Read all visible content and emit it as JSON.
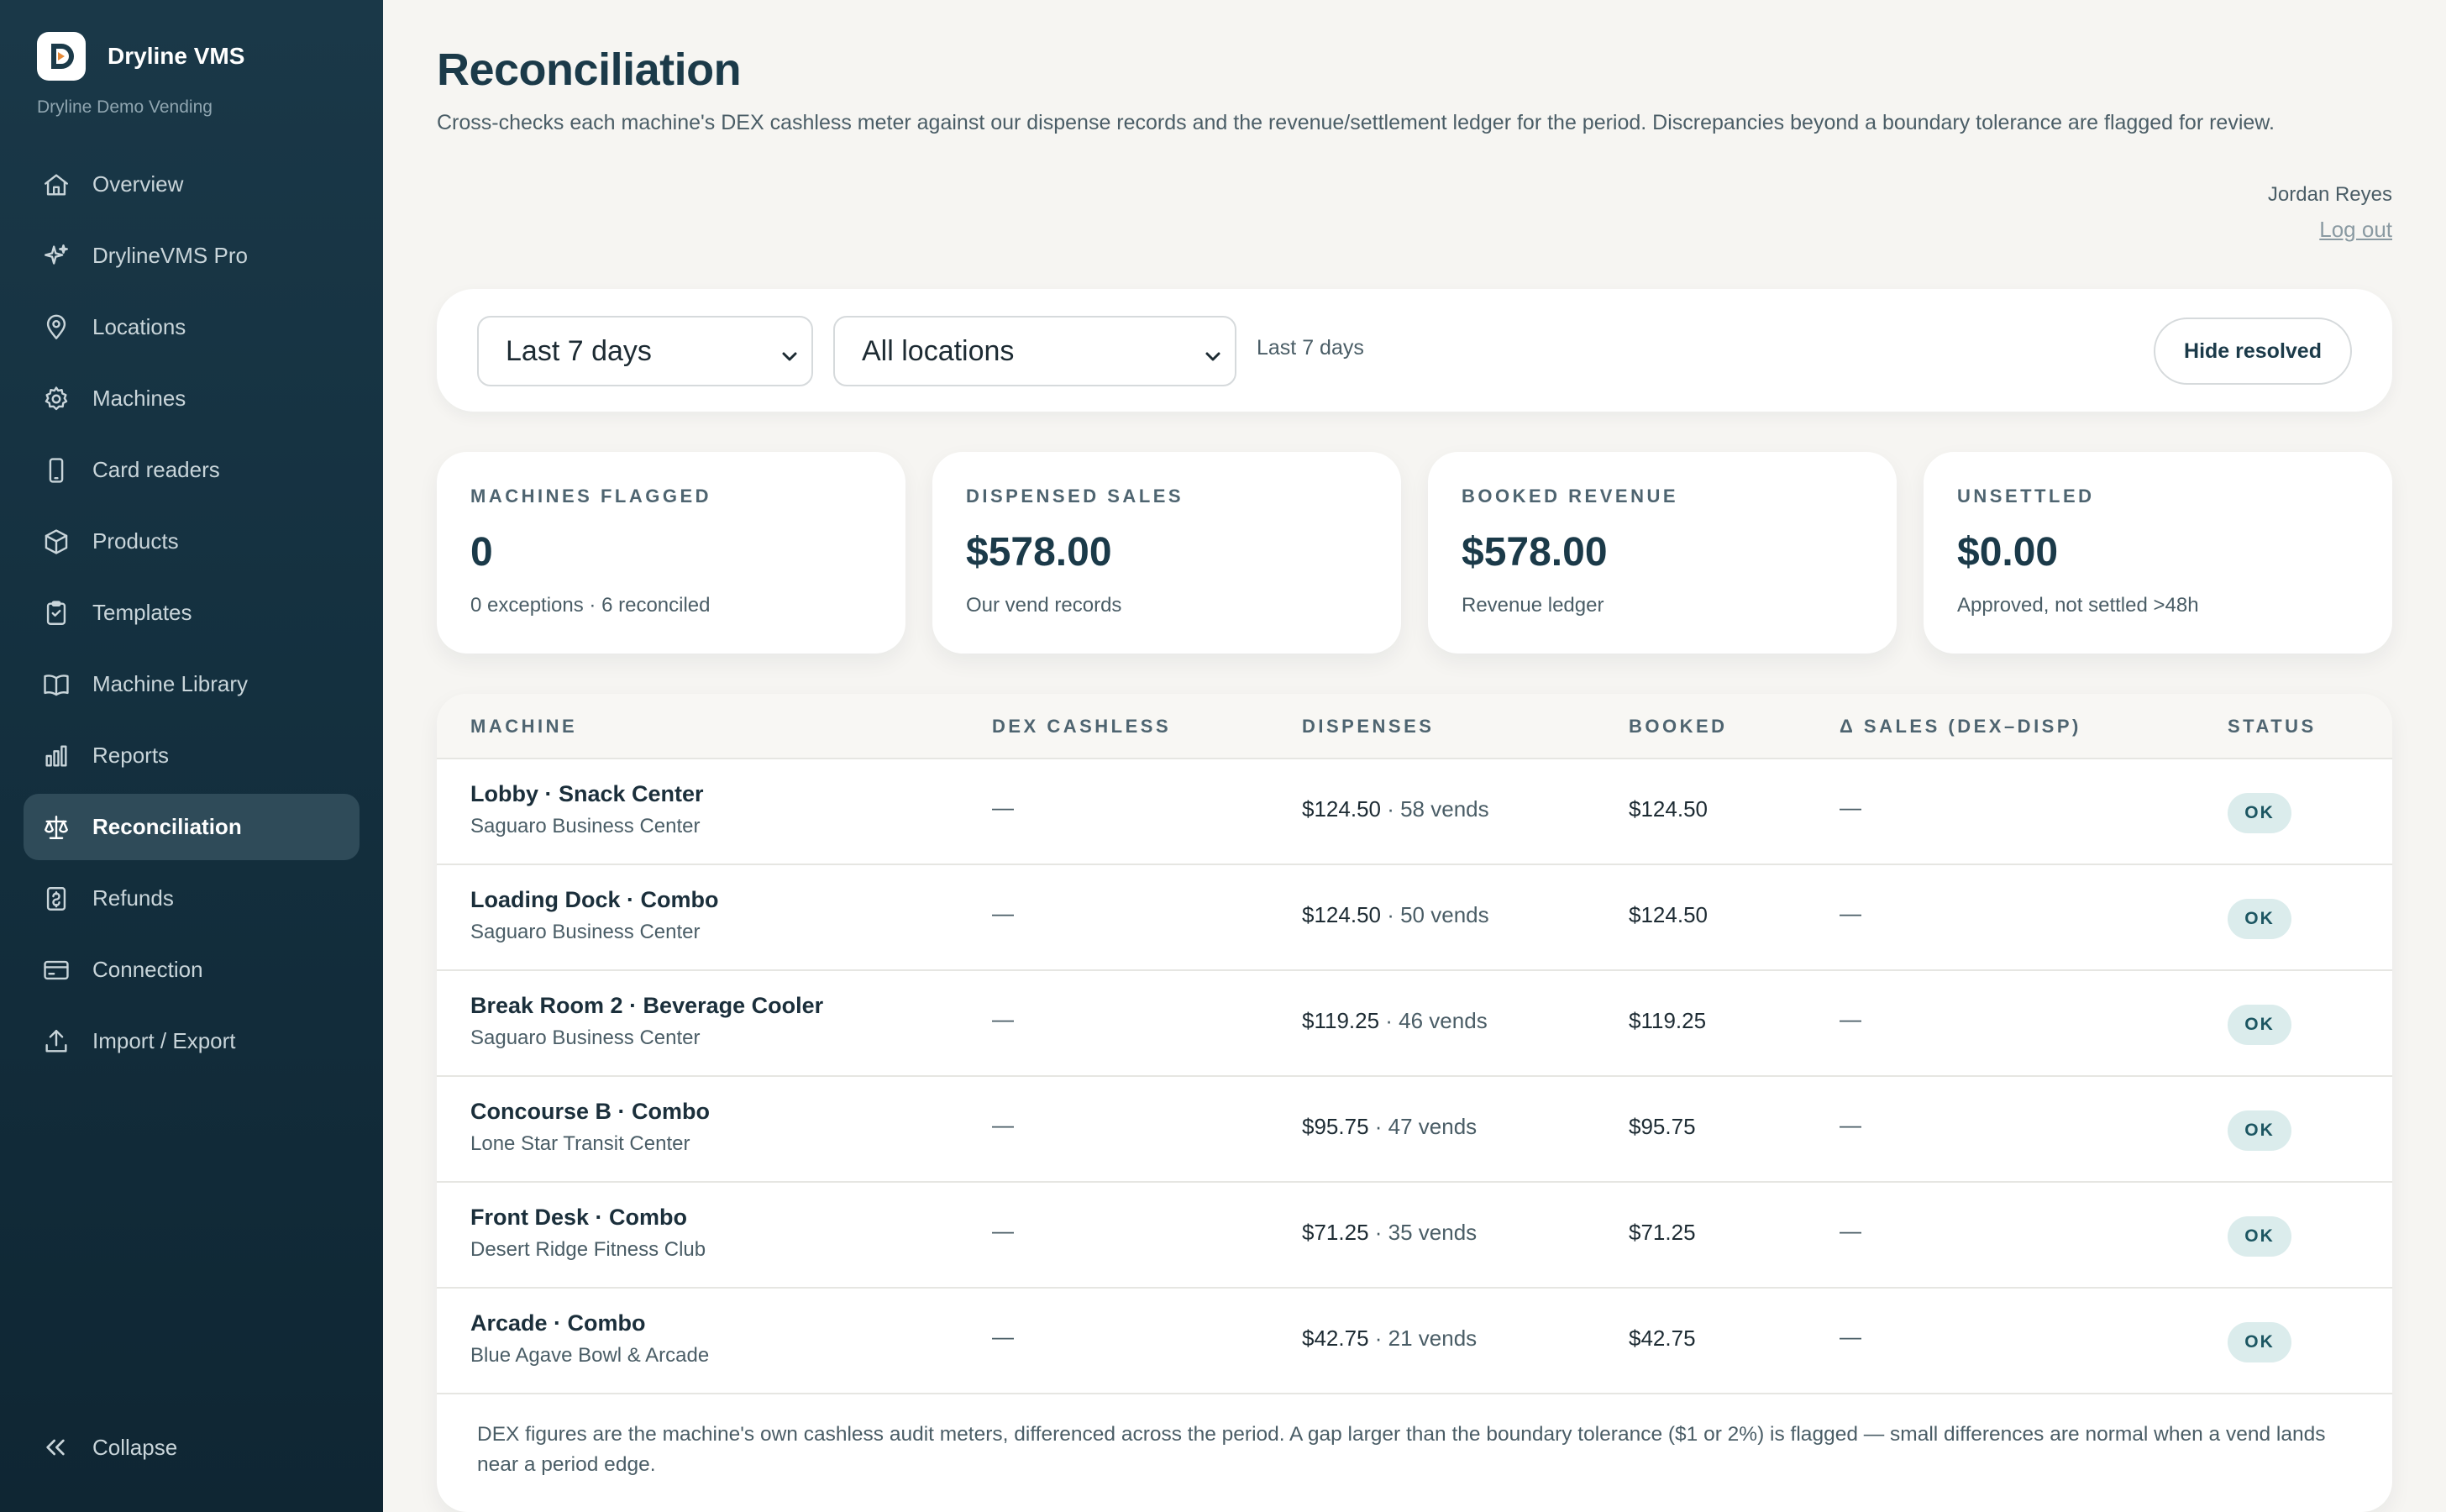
{
  "sidebar": {
    "brand_name": "Dryline VMS",
    "org_name": "Dryline Demo Vending",
    "items": [
      {
        "label": "Overview",
        "icon": "home-icon"
      },
      {
        "label": "DrylineVMS Pro",
        "icon": "sparkle-icon"
      },
      {
        "label": "Locations",
        "icon": "map-pin-icon"
      },
      {
        "label": "Machines",
        "icon": "gear-icon"
      },
      {
        "label": "Card readers",
        "icon": "phone-icon"
      },
      {
        "label": "Products",
        "icon": "box-icon"
      },
      {
        "label": "Templates",
        "icon": "clipboard-icon"
      },
      {
        "label": "Machine Library",
        "icon": "book-icon"
      },
      {
        "label": "Reports",
        "icon": "bar-chart-icon"
      },
      {
        "label": "Reconciliation",
        "icon": "scale-icon",
        "active": true
      },
      {
        "label": "Refunds",
        "icon": "receipt-icon"
      },
      {
        "label": "Connection",
        "icon": "card-icon"
      },
      {
        "label": "Import / Export",
        "icon": "upload-icon"
      }
    ],
    "collapse_label": "Collapse"
  },
  "header": {
    "title": "Reconciliation",
    "description": "Cross-checks each machine's DEX cashless meter against our dispense records and the revenue/settlement ledger for the period. Discrepancies beyond a boundary tolerance are flagged for review.",
    "user_name": "Jordan Reyes",
    "logout_label": "Log out"
  },
  "filters": {
    "period_value": "Last 7 days",
    "location_value": "All locations",
    "period_label": "Last 7 days",
    "hide_resolved_label": "Hide resolved"
  },
  "stats": [
    {
      "label": "MACHINES FLAGGED",
      "value": "0",
      "sub": "0 exceptions · 6 reconciled"
    },
    {
      "label": "DISPENSED SALES",
      "value": "$578.00",
      "sub": "Our vend records"
    },
    {
      "label": "BOOKED REVENUE",
      "value": "$578.00",
      "sub": "Revenue ledger"
    },
    {
      "label": "UNSETTLED",
      "value": "$0.00",
      "sub": "Approved, not settled >48h"
    }
  ],
  "table": {
    "columns": [
      "MACHINE",
      "DEX CASHLESS",
      "DISPENSES",
      "BOOKED",
      "Δ SALES (DEX–DISP)",
      "STATUS"
    ],
    "rows": [
      {
        "machine": "Lobby · Snack Center",
        "location": "Saguaro Business Center",
        "dex": "—",
        "dispense_amount": "$124.50",
        "dispense_vends": " · 58 vends",
        "booked": "$124.50",
        "delta": "—",
        "status": "OK"
      },
      {
        "machine": "Loading Dock · Combo",
        "location": "Saguaro Business Center",
        "dex": "—",
        "dispense_amount": "$124.50",
        "dispense_vends": " · 50 vends",
        "booked": "$124.50",
        "delta": "—",
        "status": "OK"
      },
      {
        "machine": "Break Room 2 · Beverage Cooler",
        "location": "Saguaro Business Center",
        "dex": "—",
        "dispense_amount": "$119.25",
        "dispense_vends": " · 46 vends",
        "booked": "$119.25",
        "delta": "—",
        "status": "OK"
      },
      {
        "machine": "Concourse B · Combo",
        "location": "Lone Star Transit Center",
        "dex": "—",
        "dispense_amount": "$95.75",
        "dispense_vends": " · 47 vends",
        "booked": "$95.75",
        "delta": "—",
        "status": "OK"
      },
      {
        "machine": "Front Desk · Combo",
        "location": "Desert Ridge Fitness Club",
        "dex": "—",
        "dispense_amount": "$71.25",
        "dispense_vends": " · 35 vends",
        "booked": "$71.25",
        "delta": "—",
        "status": "OK"
      },
      {
        "machine": "Arcade · Combo",
        "location": "Blue Agave Bowl & Arcade",
        "dex": "—",
        "dispense_amount": "$42.75",
        "dispense_vends": " · 21 vends",
        "booked": "$42.75",
        "delta": "—",
        "status": "OK"
      }
    ],
    "footnote": "DEX figures are the machine's own cashless audit meters, differenced across the period. A gap larger than the boundary tolerance ($1 or 2%) is flagged — small differences are normal when a vend lands near a period edge."
  },
  "colors": {
    "sidebar_bg": "#14303f",
    "accent": "#1b3a49",
    "ok_badge_bg": "#dbecec",
    "ok_badge_text": "#1c5662"
  }
}
